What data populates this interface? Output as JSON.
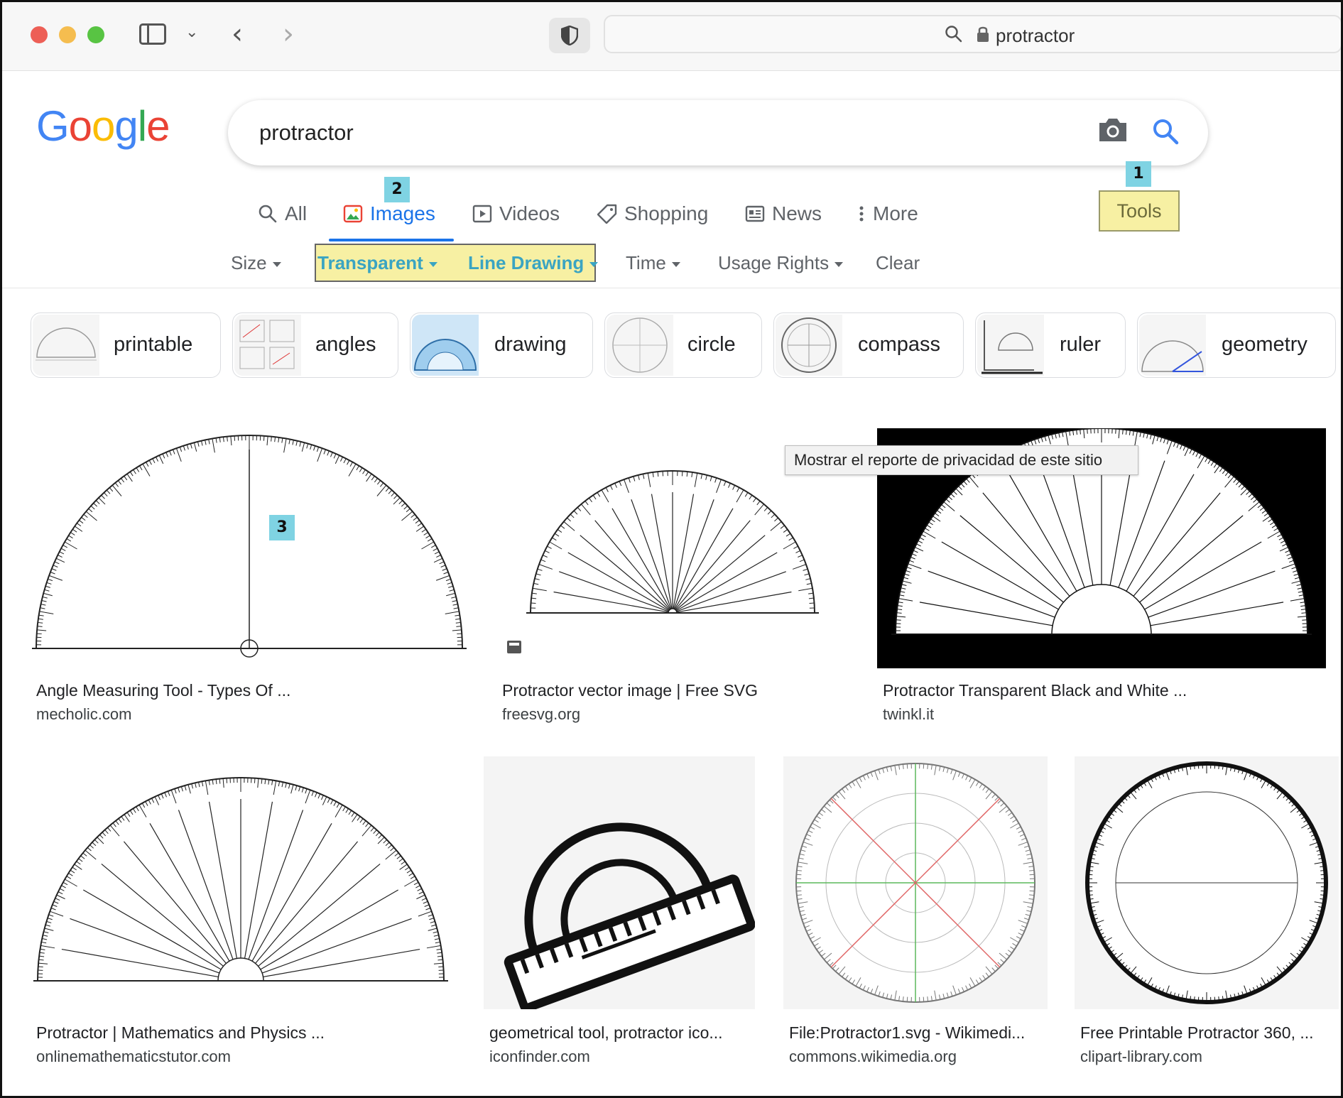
{
  "browser": {
    "address_text": "protractor"
  },
  "google": {
    "logo_letters": [
      {
        "ch": "G",
        "color": "#4285F4"
      },
      {
        "ch": "o",
        "color": "#EA4335"
      },
      {
        "ch": "o",
        "color": "#FBBC05"
      },
      {
        "ch": "g",
        "color": "#4285F4"
      },
      {
        "ch": "l",
        "color": "#34A853"
      },
      {
        "ch": "e",
        "color": "#EA4335"
      }
    ],
    "search_value": "protractor"
  },
  "tabs": [
    {
      "label": "All",
      "icon": "search-icon"
    },
    {
      "label": "Images",
      "icon": "image-icon",
      "active": true
    },
    {
      "label": "Videos",
      "icon": "video-icon"
    },
    {
      "label": "Shopping",
      "icon": "tag-icon"
    },
    {
      "label": "News",
      "icon": "news-icon"
    },
    {
      "label": "More",
      "icon": "more-vert-icon"
    }
  ],
  "tools_label": "Tools",
  "markers": {
    "tools": "1",
    "images": "2",
    "result": "3"
  },
  "filters": {
    "size": "Size",
    "transparent": "Transparent",
    "line_drawing": "Line Drawing",
    "time": "Time",
    "usage_rights": "Usage Rights",
    "clear": "Clear"
  },
  "chips": [
    "printable",
    "angles",
    "drawing",
    "circle",
    "compass",
    "ruler",
    "geometry"
  ],
  "tooltip": "Mostrar el reporte de privacidad de este sitio",
  "results": [
    {
      "title": "Angle Measuring Tool - Types Of ...",
      "source": "mecholic.com"
    },
    {
      "title": "Protractor vector image | Free SVG",
      "source": "freesvg.org"
    },
    {
      "title": "Protractor Transparent Black and White ...",
      "source": "twinkl.it"
    },
    {
      "title": "Protractor | Mathematics and Physics ...",
      "source": "onlinemathematicstutor.com"
    },
    {
      "title": "geometrical tool, protractor ico...",
      "source": "iconfinder.com"
    },
    {
      "title": "File:Protractor1.svg - Wikimedi...",
      "source": "commons.wikimedia.org"
    },
    {
      "title": "Free Printable Protractor 360, ...",
      "source": "clipart-library.com"
    }
  ],
  "colors": {
    "accent": "#1a73e8",
    "highlight": "#f7f0a3",
    "marker": "#7fd3e3"
  }
}
